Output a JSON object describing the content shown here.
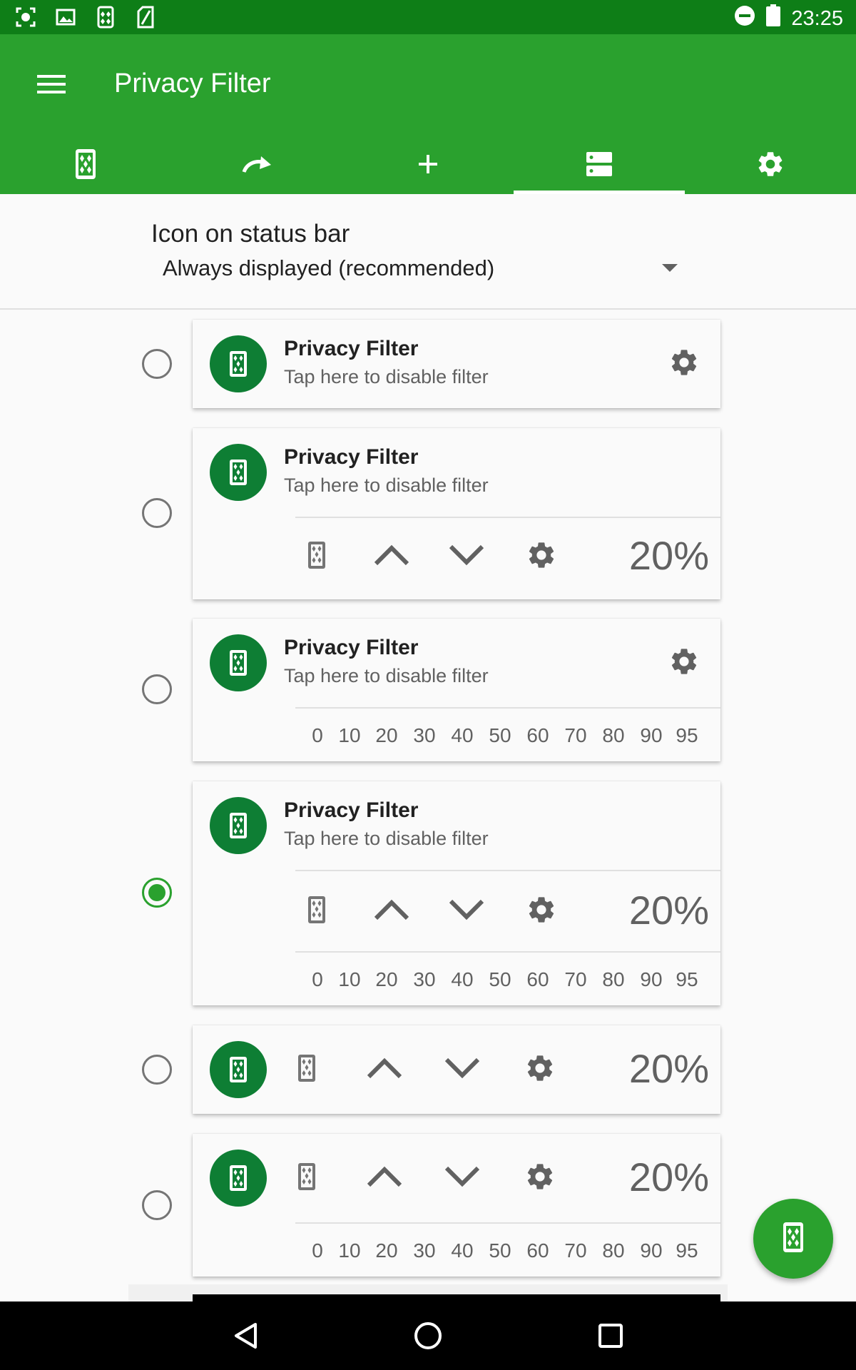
{
  "status_bar": {
    "time": "23:25",
    "left_icons": [
      "screenshot-icon",
      "image-icon",
      "privacy-filter-icon",
      "sd-card-icon"
    ],
    "right_icons": [
      "dnd-icon",
      "battery-icon"
    ]
  },
  "app_bar": {
    "title": "Privacy Filter",
    "menu_icon": "hamburger-menu-icon",
    "tabs": [
      {
        "icon": "phone-pattern-icon",
        "active": false
      },
      {
        "icon": "redo-arrow-icon",
        "active": false
      },
      {
        "icon": "plus-icon",
        "active": false
      },
      {
        "icon": "layout-list-icon",
        "active": true
      },
      {
        "icon": "gear-icon",
        "active": false
      }
    ]
  },
  "status_icon_setting": {
    "label": "Icon on status bar",
    "value": "Always displayed (recommended)"
  },
  "notification_styles": {
    "title": "Privacy Filter",
    "subtitle": "Tap here to disable filter",
    "percent": "20%",
    "scale": [
      "0",
      "10",
      "20",
      "30",
      "40",
      "50",
      "60",
      "70",
      "80",
      "90",
      "95"
    ],
    "selected_index": 3
  },
  "colors": {
    "status_bar": "#0e7e17",
    "app_bar": "#2aa12e",
    "app_icon_bg": "#0e7e34",
    "accent": "#2aa12e"
  }
}
